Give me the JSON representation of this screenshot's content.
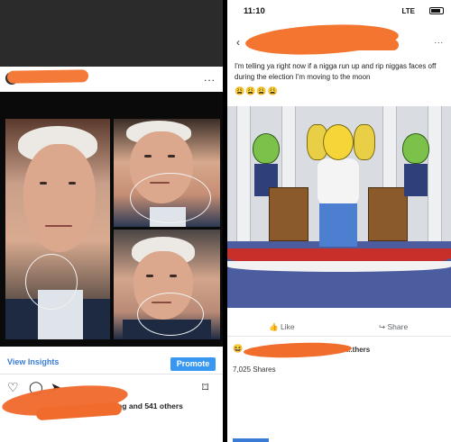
{
  "left_post": {
    "more_icon": "...",
    "view_insights": "View Insights",
    "promote": "Promote",
    "likes_visible": "...anything and 541 others",
    "icons": [
      "heart-icon",
      "comment-icon",
      "send-icon",
      "bookmark-icon"
    ]
  },
  "right_post": {
    "status": {
      "time": "11:10",
      "network": "LTE"
    },
    "more_icon": "...",
    "text": "I'm telling ya right now if a nigga run up and rip niggas faces off during the election I'm moving to the moon",
    "emojis": "😩😩😩😩",
    "like_label": "Like",
    "share_label": "Share",
    "reactions_tail": "...thers",
    "shares": "7,025 Shares"
  },
  "colors": {
    "redaction": "#f3752f",
    "instagram_blue": "#3897f0",
    "facebook_gray": "#5f6368"
  }
}
